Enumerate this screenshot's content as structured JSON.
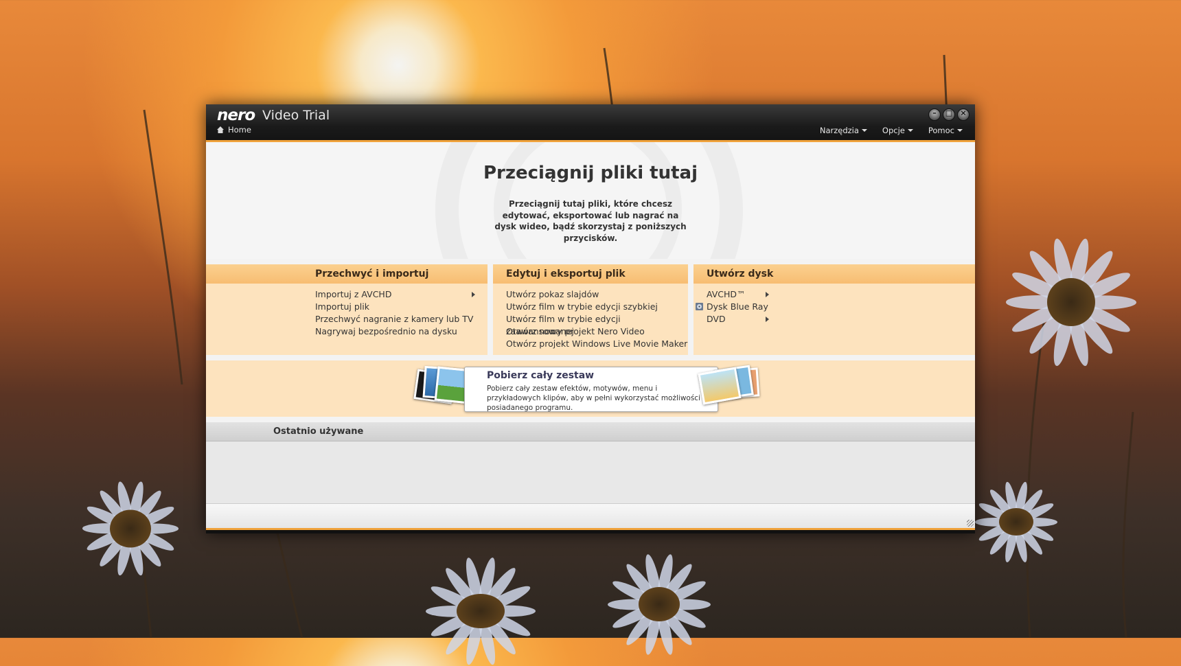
{
  "window": {
    "logo_text": "nero",
    "title": "Video Trial",
    "home_label": "Home",
    "menus": [
      {
        "label": "Narzędzia"
      },
      {
        "label": "Opcje"
      },
      {
        "label": "Pomoc"
      }
    ]
  },
  "drop_zone": {
    "title": "Przeciągnij pliki tutaj",
    "description": "Przeciągnij tutaj pliki, które chcesz edytować, eksportować lub nagrać na dysk wideo, bądź skorzystaj z poniższych przycisków."
  },
  "panels": [
    {
      "title": "Przechwyć i importuj",
      "items": [
        {
          "label": "Importuj z AVCHD",
          "submenu": true
        },
        {
          "label": "Importuj plik"
        },
        {
          "label": "Przechwyć nagranie z kamery lub TV"
        },
        {
          "label": "Nagrywaj bezpośrednio na dysku"
        }
      ]
    },
    {
      "title": "Edytuj i eksportuj plik",
      "items": [
        {
          "label": "Utwórz pokaz slajdów"
        },
        {
          "label": "Utwórz film w trybie edycji szybkiej"
        },
        {
          "label": "Utwórz film w trybie edycji zaawansowanej"
        },
        {
          "label": "Otwórz nowy projekt Nero Video"
        },
        {
          "label": "Otwórz projekt Windows Live Movie Maker"
        }
      ]
    },
    {
      "title": "Utwórz dysk",
      "items": [
        {
          "label": "AVCHD™",
          "submenu": true
        },
        {
          "label": "Dysk Blue Ray",
          "icon": "disc-icon"
        },
        {
          "label": "DVD",
          "submenu": true
        }
      ]
    }
  ],
  "promo": {
    "title": "Pobierz cały zestaw",
    "description": "Pobierz cały zestaw efektów, motywów, menu i przykładowych klipów, aby w pełni wykorzystać możliwości posiadanego programu."
  },
  "recent": {
    "title": "Ostatnio używane"
  },
  "colors": {
    "accent": "#f0a23b",
    "panel_bg": "#fde3be",
    "panel_head": "#f7bd72"
  }
}
